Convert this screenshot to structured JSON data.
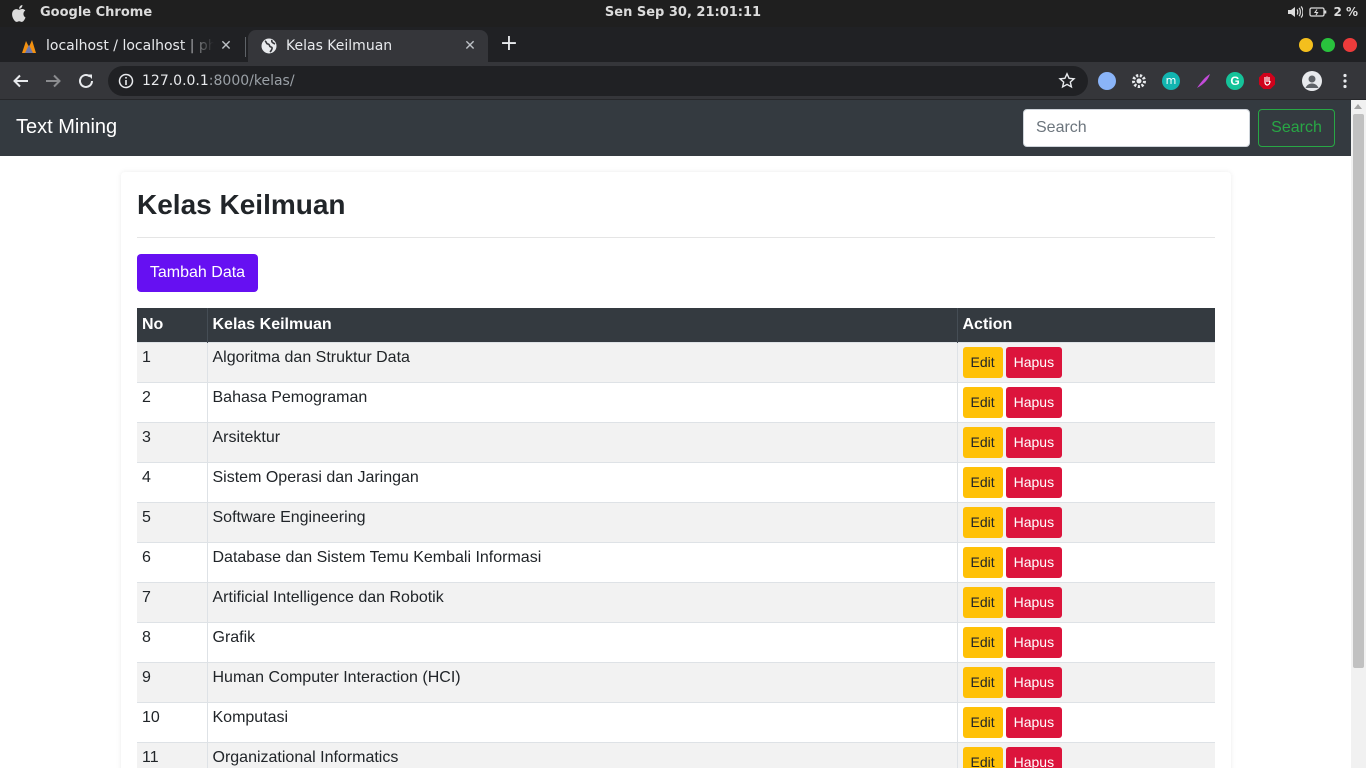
{
  "os": {
    "app_name": "Google Chrome",
    "clock": "Sen Sep 30, 21:01:11",
    "battery": "2 %"
  },
  "browser": {
    "tabs": [
      {
        "title": "localhost / localhost | phpMyAdmin",
        "icon": "phpmyadmin-icon"
      },
      {
        "title": "Kelas Keilmuan",
        "icon": "globe-icon"
      }
    ],
    "url_host": "127.0.0.1",
    "url_rest": ":8000/kelas/"
  },
  "navbar": {
    "brand": "Text Mining",
    "search_placeholder": "Search",
    "search_button": "Search"
  },
  "page": {
    "title": "Kelas Keilmuan",
    "add_button": "Tambah Data"
  },
  "table": {
    "headers": [
      "No",
      "Kelas Keilmuan",
      "Action"
    ],
    "edit_label": "Edit",
    "delete_label": "Hapus",
    "rows": [
      {
        "no": "1",
        "name": "Algoritma dan Struktur Data"
      },
      {
        "no": "2",
        "name": "Bahasa Pemograman"
      },
      {
        "no": "3",
        "name": "Arsitektur"
      },
      {
        "no": "4",
        "name": "Sistem Operasi dan Jaringan"
      },
      {
        "no": "5",
        "name": "Software Engineering"
      },
      {
        "no": "6",
        "name": "Database dan Sistem Temu Kembali Informasi"
      },
      {
        "no": "7",
        "name": "Artificial Intelligence dan Robotik"
      },
      {
        "no": "8",
        "name": "Grafik"
      },
      {
        "no": "9",
        "name": "Human Computer Interaction (HCI)"
      },
      {
        "no": "10",
        "name": "Komputasi"
      },
      {
        "no": "11",
        "name": "Organizational Informatics"
      }
    ]
  },
  "colors": {
    "navbar_bg": "#343a40",
    "primary_purple": "#6610f2",
    "edit_yellow": "#ffc107",
    "delete_red": "#dc143c",
    "search_green": "#28a745"
  }
}
